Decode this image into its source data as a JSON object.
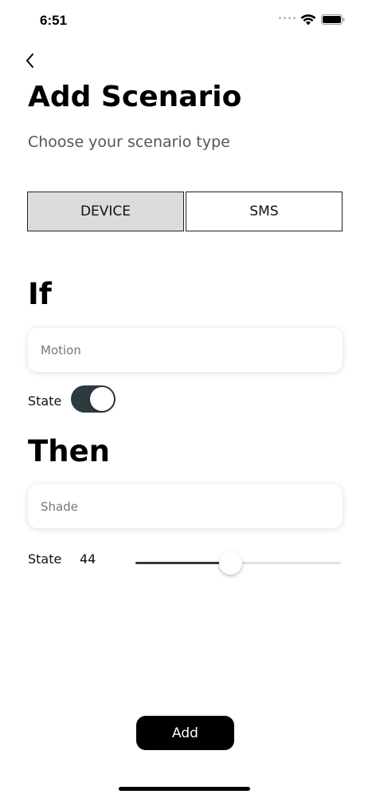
{
  "status_bar": {
    "time": "6:51",
    "icons": [
      "signal-dots-icon",
      "wifi-icon",
      "battery-icon"
    ]
  },
  "navigation": {
    "back_icon": "chevron-left-icon"
  },
  "header": {
    "title": "Add Scenario",
    "subtitle": "Choose your scenario type"
  },
  "scenario_type": {
    "options": [
      "DEVICE",
      "SMS"
    ],
    "selected": "DEVICE"
  },
  "if_section": {
    "heading": "If",
    "device_placeholder": "Motion",
    "state_label": "State",
    "state_on": true
  },
  "then_section": {
    "heading": "Then",
    "device_placeholder": "Shade",
    "state_label": "State",
    "state_value": "44",
    "slider_fraction": 0.46
  },
  "actions": {
    "add_label": "Add"
  },
  "colors": {
    "accent": "#2d3a40",
    "selected_segment": "#dcdcdc",
    "primary_button": "#000000"
  }
}
